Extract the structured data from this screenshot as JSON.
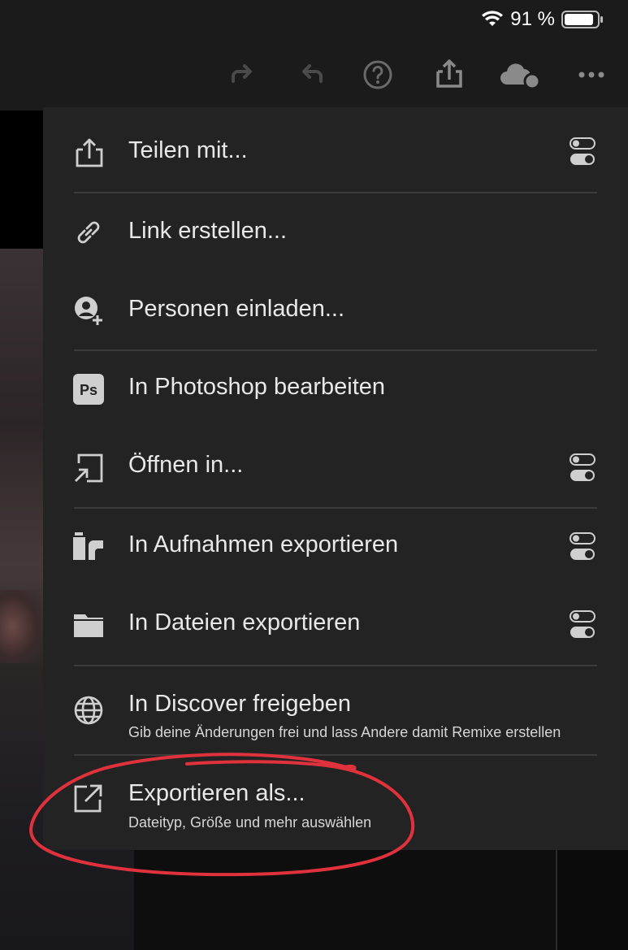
{
  "status_bar": {
    "battery_percent": "91 %",
    "battery_level": 0.91
  },
  "toolbar": {
    "icons": [
      "redo-icon",
      "undo-icon",
      "help-icon",
      "share-icon",
      "cloud-sync-icon",
      "more-icon"
    ]
  },
  "menu": {
    "items": [
      {
        "label": "Teilen mit...",
        "icon": "share-icon",
        "has_toggle": true
      },
      {
        "label": "Link erstellen...",
        "icon": "link-icon",
        "has_toggle": false
      },
      {
        "label": "Personen einladen...",
        "icon": "invite-person-icon",
        "has_toggle": false
      },
      {
        "label": "In Photoshop bearbeiten",
        "icon": "photoshop-icon",
        "icon_text": "Ps",
        "has_toggle": false
      },
      {
        "label": "Öffnen in...",
        "icon": "open-in-icon",
        "has_toggle": true
      },
      {
        "label": "In Aufnahmen exportieren",
        "icon": "camera-roll-icon",
        "has_toggle": true
      },
      {
        "label": "In Dateien exportieren",
        "icon": "folder-icon",
        "has_toggle": true
      },
      {
        "label": "In Discover freigeben",
        "sublabel": "Gib deine Änderungen frei und lass Andere damit Remixe erstellen",
        "icon": "globe-icon",
        "has_toggle": false
      },
      {
        "label": "Exportieren als...",
        "sublabel": "Dateityp, Größe und mehr auswählen",
        "icon": "export-icon",
        "has_toggle": false
      }
    ]
  },
  "colors": {
    "menu_bg": "#232323",
    "annotation": "#e0323c"
  }
}
